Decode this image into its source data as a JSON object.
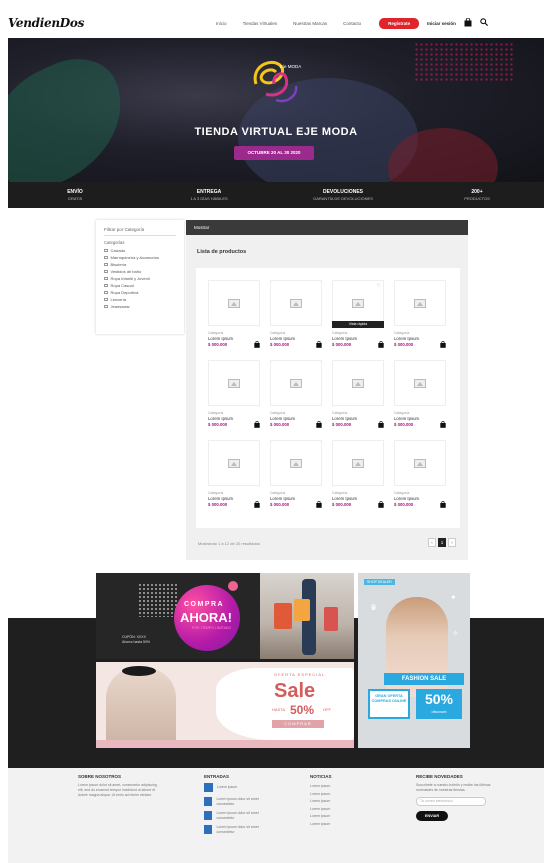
{
  "header": {
    "logo": "VendienDos",
    "nav": [
      "Inicio",
      "Tiendas Virtuales",
      "Nuestras Marcas",
      "Contacto"
    ],
    "register_button": "Regístrate",
    "login": "Iniciar sesión",
    "cart_icon": "bag-icon",
    "search_icon": "search-icon"
  },
  "hero": {
    "emblem_text": "Eje MODA",
    "title": "TIENDA VIRTUAL EJE MODA",
    "date": "OCTUBRE 20 AL 30 2020"
  },
  "info_bar": [
    {
      "title": "ENVÍO",
      "sub": "GRATIS"
    },
    {
      "title": "ENTREGA",
      "sub": "1 A 3 DÍAS HÁBILES"
    },
    {
      "title": "DEVOLUCIONES",
      "sub": "GARANTÍA DE DEVOLUCIONES"
    },
    {
      "title": "200+",
      "sub": "PRODUCTOS"
    }
  ],
  "sidebar": {
    "title": "Filtrar por Categoría",
    "heading": "Categorías",
    "items": [
      "Calzado",
      "Marroquinería y Accesorios",
      "Bisutería",
      "Vestidos de baño",
      "Ropa Infantil y Juvenil",
      "Ropa Casual",
      "Ropa Deportiva",
      "Lencería",
      "Jeanswear"
    ]
  },
  "panel": {
    "breadcrumb": "Mostrar",
    "title": "Lista de productos",
    "product_category": "Categoría",
    "product_name": "Lorem Ipsum",
    "product_price": "$ 000.000",
    "quick_view": "Vista rápida",
    "pagination_text": "Mostrando 1 a 12 de 20 resultados",
    "pages": [
      "‹",
      "1",
      "›"
    ]
  },
  "banners": {
    "compra": "COMPRA",
    "ahora": "AHORA!",
    "ahora_sub": "POR TIEMPO LIMITADO",
    "codigo": "CUPÓN: XXXX\nAhorra hasta 50%",
    "oferta": "OFERTA ESPECIAL",
    "sale": "Sale",
    "hasta": "HASTA",
    "pct": "50%",
    "off": "OFF",
    "comprar": "COMPRAR",
    "shop_tag": "SHOP DEALER",
    "fashion_sale": "FASHION SALE",
    "oferta_box": "GRAN OFERTA COMPRAS ONLINE",
    "pct2": "50%",
    "discount": "discount"
  },
  "footer": {
    "col1_title": "SOBRE NOSOTROS",
    "col1_text": "Lorem ipsum dolor sit amet, consectetur adipiscing elit, sed do eiusmod tempor incididunt ut labore et dolore magna aliqua. Ut enim ad minim veniam.",
    "col2_title": "ENTRADAS",
    "col2_items": [
      "Lorem ipsum",
      "Lorem ipsum dolor sit amet consectetur",
      "Lorem ipsum dolor sit amet consectetur",
      "Lorem ipsum dolor sit amet consectetur"
    ],
    "col3_title": "NOTICIAS",
    "col3_links": [
      "Lorem ipsum",
      "Lorem ipsum",
      "Lorem ipsum",
      "Lorem ipsum",
      "Lorem ipsum",
      "Lorem ipsum"
    ],
    "col4_title": "RECIBE NOVEDADES",
    "col4_text": "Suscríbete a nuestro boletín y recibe las últimas novedades de nuestras tiendas.",
    "email_placeholder": "Tu correo electrónico",
    "send_button": "ENVIAR"
  },
  "colors": {
    "accent_red": "#e0242c",
    "brand_purple": "#9b2a8c",
    "price_magenta": "#a01a7d",
    "dark": "#1f1f1f"
  }
}
